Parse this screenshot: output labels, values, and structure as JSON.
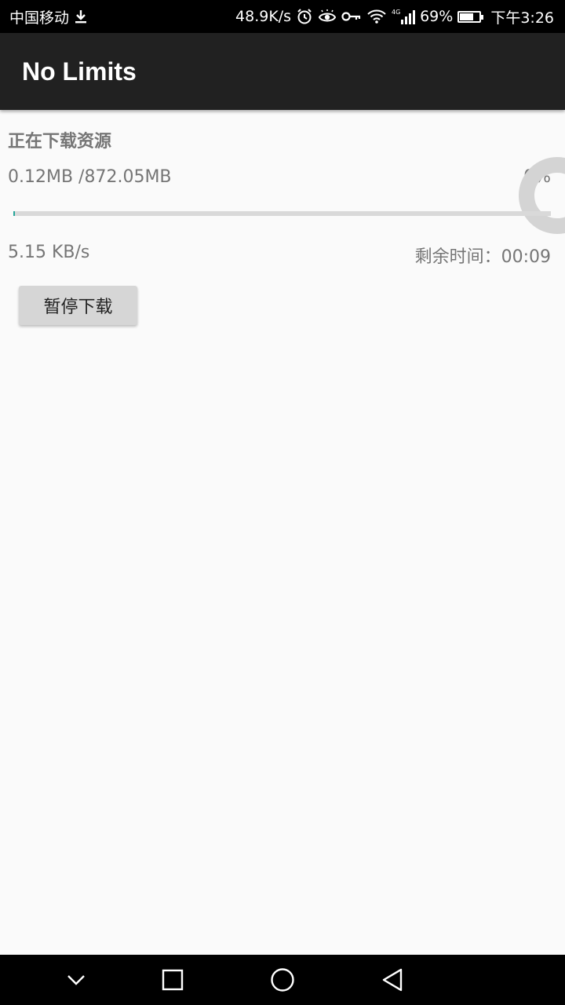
{
  "status_bar": {
    "carrier": "中国移动",
    "speed": "48.9K/s",
    "battery": "69%",
    "battery_fraction": 0.69,
    "time": "下午3:26",
    "icons": [
      "download-icon",
      "alarm-icon",
      "eye-icon",
      "key-icon",
      "wifi-icon",
      "signal-4g-icon",
      "battery-icon"
    ]
  },
  "app_bar": {
    "title": "No Limits"
  },
  "download": {
    "section_title": "正在下载资源",
    "size_text": "0.12MB /872.05MB",
    "percent_text": "0%",
    "progress_fraction": 0.001,
    "speed_text": "5.15 KB/s",
    "remaining_text": "剩余时间：00:09",
    "pause_button_label": "暂停下载"
  },
  "nav_bar": {
    "buttons": [
      "chevron-down-icon",
      "recent-apps-icon",
      "home-icon",
      "back-icon"
    ]
  },
  "colors": {
    "app_bar_bg": "#212121",
    "progress_accent": "#26a69a",
    "text_secondary": "#757575"
  }
}
